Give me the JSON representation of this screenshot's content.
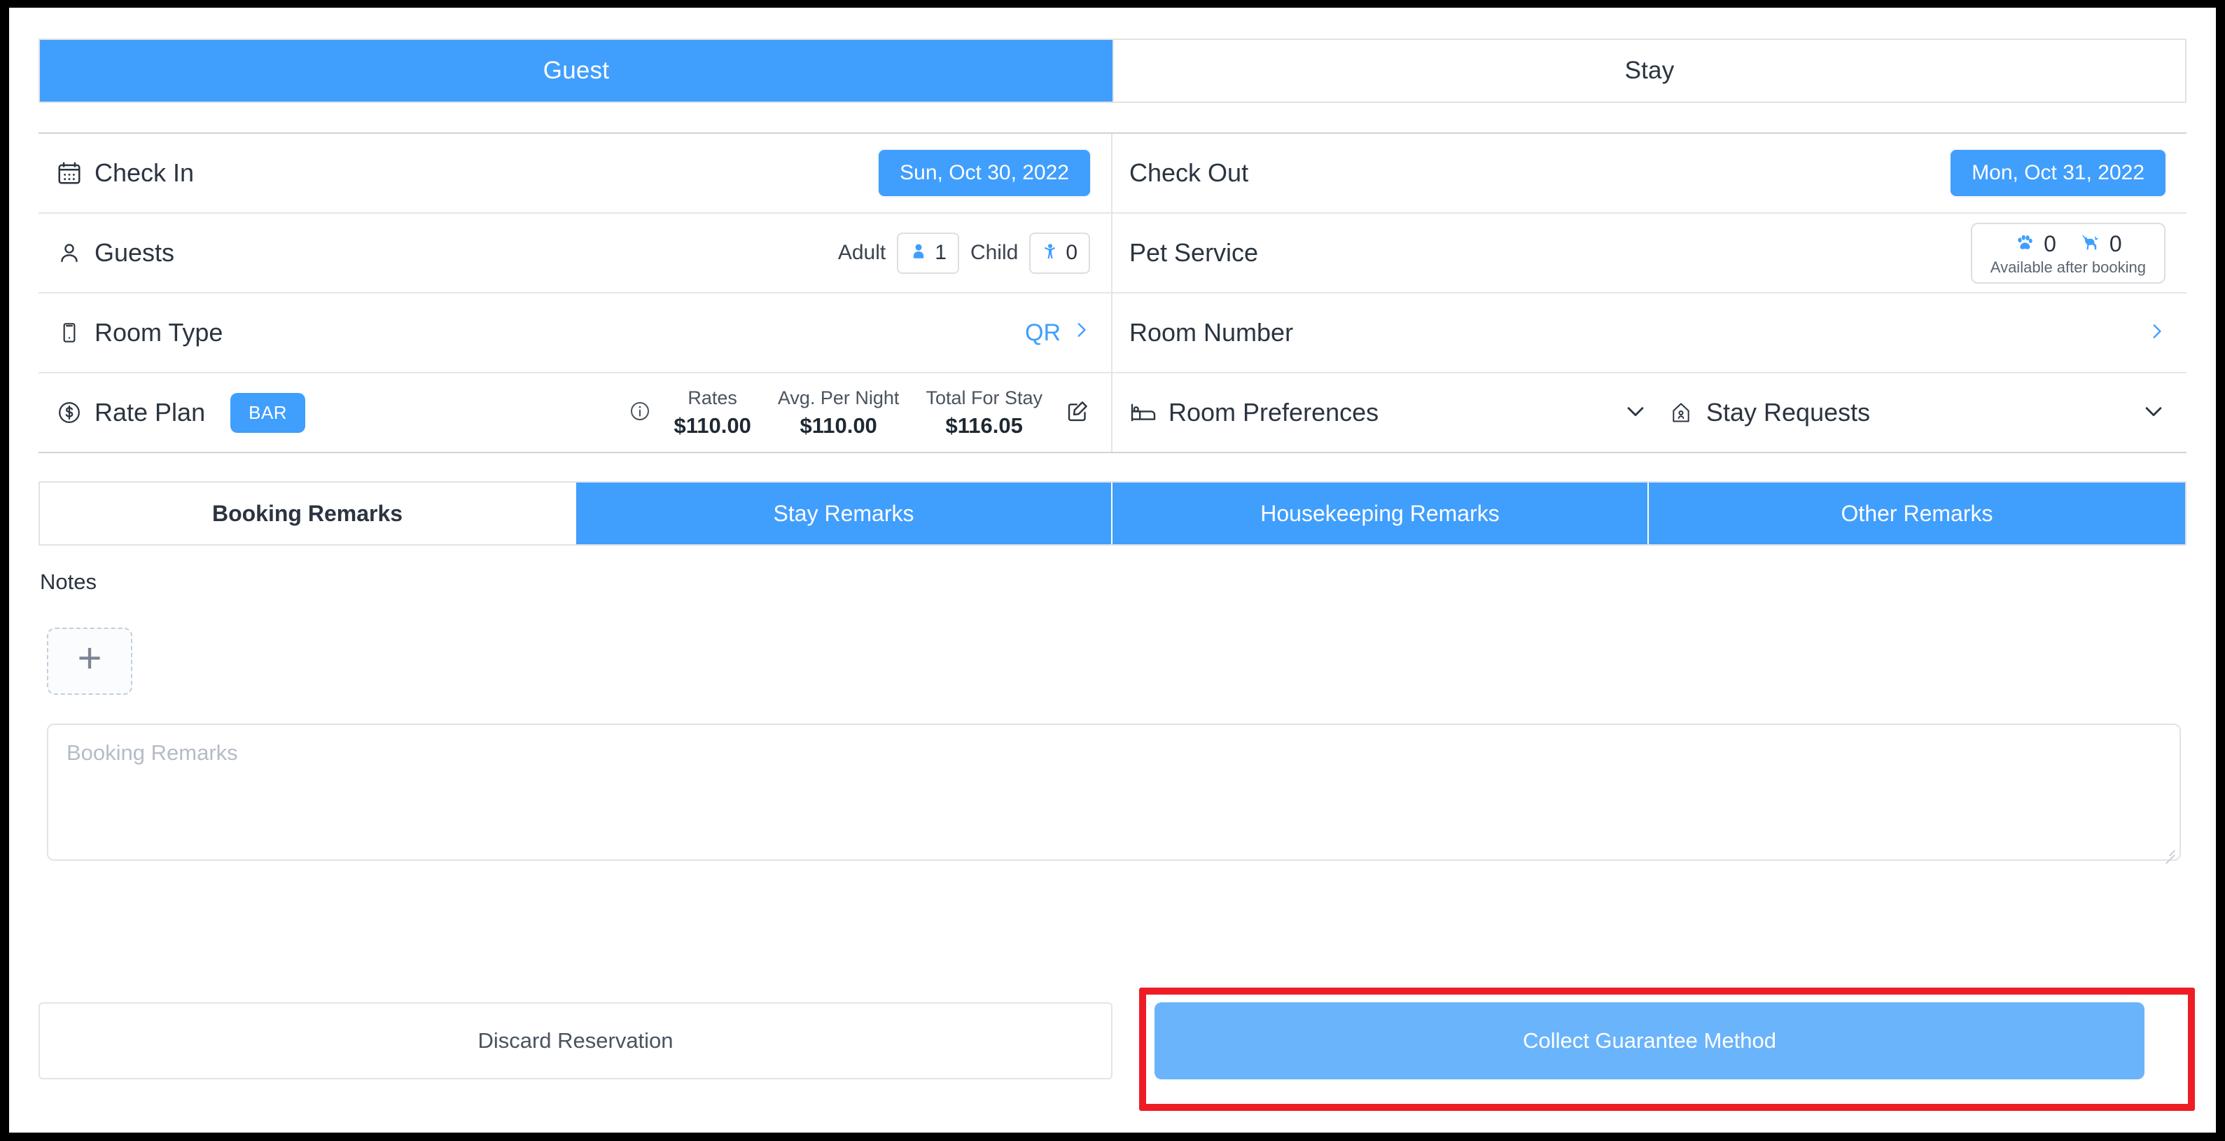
{
  "top_tabs": [
    {
      "label": "Guest",
      "active": true
    },
    {
      "label": "Stay",
      "active": false
    }
  ],
  "details": {
    "check_in": {
      "label": "Check In",
      "value": "Sun, Oct 30, 2022"
    },
    "check_out": {
      "label": "Check Out",
      "value": "Mon, Oct 31, 2022"
    },
    "guests": {
      "label": "Guests",
      "adult_label": "Adult",
      "adult_count": "1",
      "child_label": "Child",
      "child_count": "0"
    },
    "pet_service": {
      "label": "Pet Service",
      "paw_count": "0",
      "dog_count": "0",
      "note": "Available after booking"
    },
    "room_type": {
      "label": "Room Type",
      "action": "QR"
    },
    "room_number": {
      "label": "Room Number"
    },
    "rate_plan": {
      "label": "Rate Plan",
      "badge": "BAR",
      "columns": [
        {
          "title": "Rates",
          "value": "$110.00"
        },
        {
          "title": "Avg. Per Night",
          "value": "$110.00"
        },
        {
          "title": "Total For Stay",
          "value": "$116.05"
        }
      ]
    },
    "room_preferences": {
      "label": "Room Preferences"
    },
    "stay_requests": {
      "label": "Stay Requests"
    }
  },
  "remark_tabs": [
    {
      "label": "Booking Remarks",
      "active": true
    },
    {
      "label": "Stay Remarks",
      "active": false
    },
    {
      "label": "Housekeeping Remarks",
      "active": false
    },
    {
      "label": "Other Remarks",
      "active": false
    }
  ],
  "notes": {
    "label": "Notes",
    "add_label": "+"
  },
  "remarks_input": {
    "placeholder": "Booking Remarks",
    "value": ""
  },
  "footer": {
    "discard_label": "Discard Reservation",
    "collect_label": "Collect Guarantee Method"
  },
  "colors": {
    "accent_blue": "#409efd",
    "collect_blue": "#6ab4fb",
    "annotation_red": "#ee1c25",
    "text_dark": "#2b3440",
    "border_grey": "#e3e6ea"
  }
}
